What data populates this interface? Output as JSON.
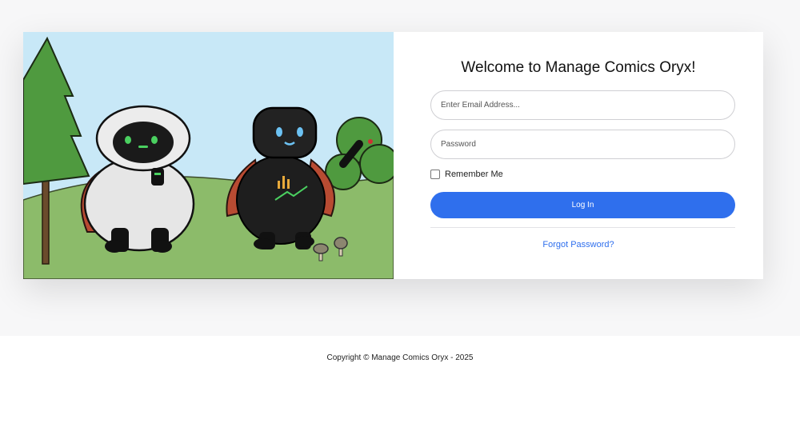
{
  "login": {
    "title": "Welcome to Manage Comics Oryx!",
    "email_placeholder": "Enter Email Address...",
    "password_placeholder": "Password",
    "remember_label": "Remember Me",
    "login_label": "Log In",
    "forgot_label": "Forgot Password?"
  },
  "illustration": {
    "description_icon": "robots-mascot-illustration"
  },
  "colors": {
    "accent": "#2f6fed",
    "sky": "#c8e8f7",
    "grass": "#8cbb6a"
  },
  "footer": {
    "copyright": "Copyright © Manage Comics Oryx - 2025"
  }
}
